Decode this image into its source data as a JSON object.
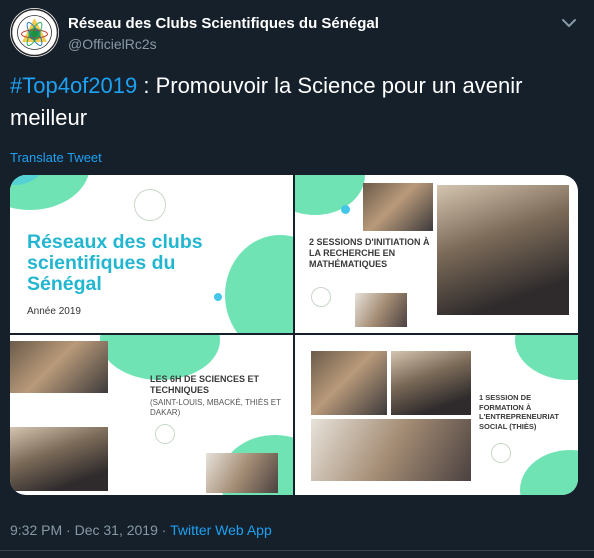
{
  "account": {
    "display_name": "Réseau des Clubs Scientifiques du Sénégal",
    "handle": "@OfficielRc2s",
    "avatar_icon": "rc2s-logo-icon",
    "menu_icon": "chevron-down-icon"
  },
  "tweet": {
    "hashtag": "#Top4of2019",
    "text_rest": " : Promouvoir la Science pour un avenir meilleur",
    "translate_label": "Translate Tweet",
    "timestamp": "9:32 PM · Dec 31, 2019 · ",
    "via": "Twitter Web App"
  },
  "media": {
    "tile1": {
      "title": "Réseaux des clubs scientifiques du Sénégal",
      "year": "Année 2019"
    },
    "tile2": {
      "caption": "2 sessions d'initiation à la recherche en mathématiques"
    },
    "tile3": {
      "caption": "Les 6H de sciences et techniques",
      "sub": "(Saint-Louis, Mbacké, Thiès et Dakar)"
    },
    "tile4": {
      "caption": "1 session de formation à l'entrepreneuriat social (Thiès)"
    }
  },
  "colors": {
    "background": "#15202b",
    "accent": "#1da1f2",
    "secondary_text": "#8899a6",
    "slide_title": "#22b6d0",
    "slide_green": "#6fe3b4"
  }
}
